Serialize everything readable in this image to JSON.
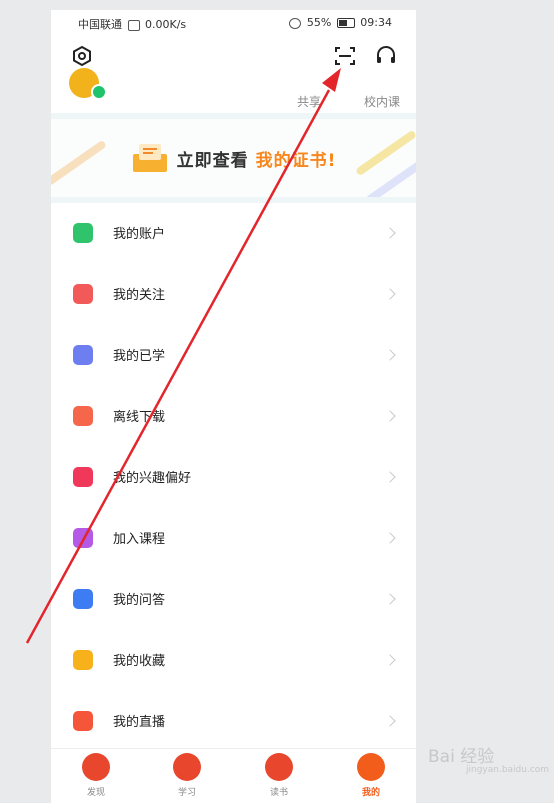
{
  "status_bar": {
    "carrier": "中国联通",
    "speed": "0.00K/s",
    "battery": "55%",
    "time": "09:34"
  },
  "toolbar": {
    "settings_icon": "gear-hexagon-icon",
    "scan_icon": "scan-icon",
    "support_icon": "headset-icon"
  },
  "profile_strip": {
    "link1": "共享",
    "link2": "校内课"
  },
  "banner": {
    "text_prefix": "立即查看",
    "text_highlight": "我的证书!"
  },
  "menu": [
    {
      "label": "我的账户",
      "icon": "wallet-icon",
      "color": "#2fc36b"
    },
    {
      "label": "我的关注",
      "icon": "heart-icon",
      "color": "#f25a5a"
    },
    {
      "label": "我的已学",
      "icon": "graduation-cap-icon",
      "color": "#6d7ff0"
    },
    {
      "label": "离线下载",
      "icon": "download-icon",
      "color": "#f5664a"
    },
    {
      "label": "我的兴趣偏好",
      "icon": "interest-heart-icon",
      "color": "#f0385a"
    },
    {
      "label": "加入课程",
      "icon": "course-icon",
      "color": "#b45ae6"
    },
    {
      "label": "我的问答",
      "icon": "qa-icon",
      "color": "#3d7cf2"
    },
    {
      "label": "我的收藏",
      "icon": "star-icon",
      "color": "#f7b21b"
    },
    {
      "label": "我的直播",
      "icon": "live-icon",
      "color": "#f5563a"
    }
  ],
  "tabs": [
    {
      "label": "发现",
      "color": "#e8472e"
    },
    {
      "label": "学习",
      "color": "#e8472e"
    },
    {
      "label": "读书",
      "color": "#e8472e"
    },
    {
      "label": "我的",
      "color": "#f25d1c"
    }
  ],
  "watermark": {
    "brand": "Bai 经验",
    "url": "jingyan.baidu.com"
  },
  "colors": {
    "accent": "#f7871c",
    "arrow": "#e3262b"
  }
}
